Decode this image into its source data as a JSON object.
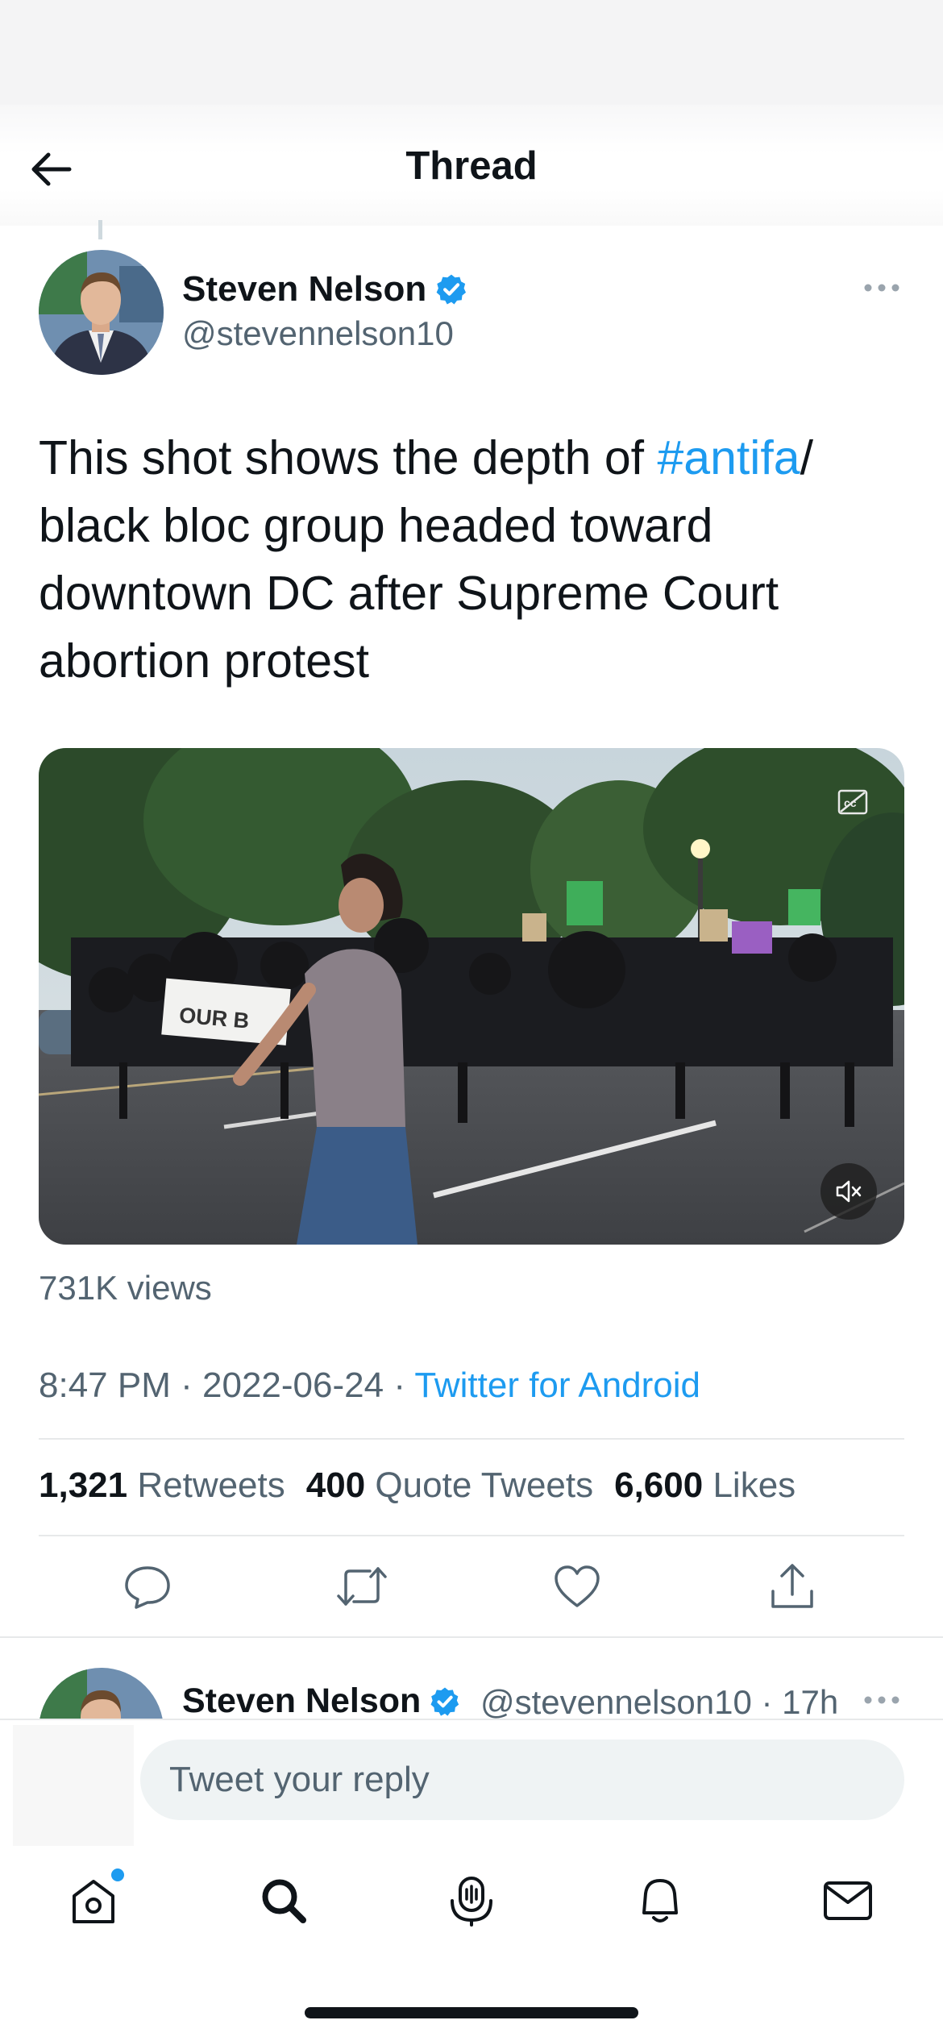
{
  "header": {
    "title": "Thread"
  },
  "tweet": {
    "author_name": "Steven Nelson",
    "author_handle": "@stevennelson10",
    "text_before": "This shot shows the depth of ",
    "hashtag": "#antifa",
    "text_after": "/ black bloc group headed toward downtown DC after Supreme Court abortion protest",
    "video_sign_text": "OUR B",
    "views": "731K views",
    "time": "8:47 PM",
    "date": "2022-06-24",
    "source": "Twitter for Android",
    "separator": "·",
    "retweets_count": "1,321",
    "retweets_label": "Retweets",
    "quotes_count": "400",
    "quotes_label": "Quote Tweets",
    "likes_count": "6,600",
    "likes_label": "Likes"
  },
  "reply": {
    "author_name": "Steven Nelson",
    "handle_time": "@stevennelson10 · 17h"
  },
  "compose": {
    "placeholder": "Tweet your reply"
  },
  "tabbar": {
    "items": [
      "home-icon",
      "search-icon",
      "spaces-icon",
      "notifications-icon",
      "messages-icon"
    ],
    "has_new_home_content": true
  },
  "colors": {
    "accent": "#1d9bf0",
    "text": "#0f1419",
    "secondary": "#536471",
    "divider": "#e7e9ea"
  }
}
